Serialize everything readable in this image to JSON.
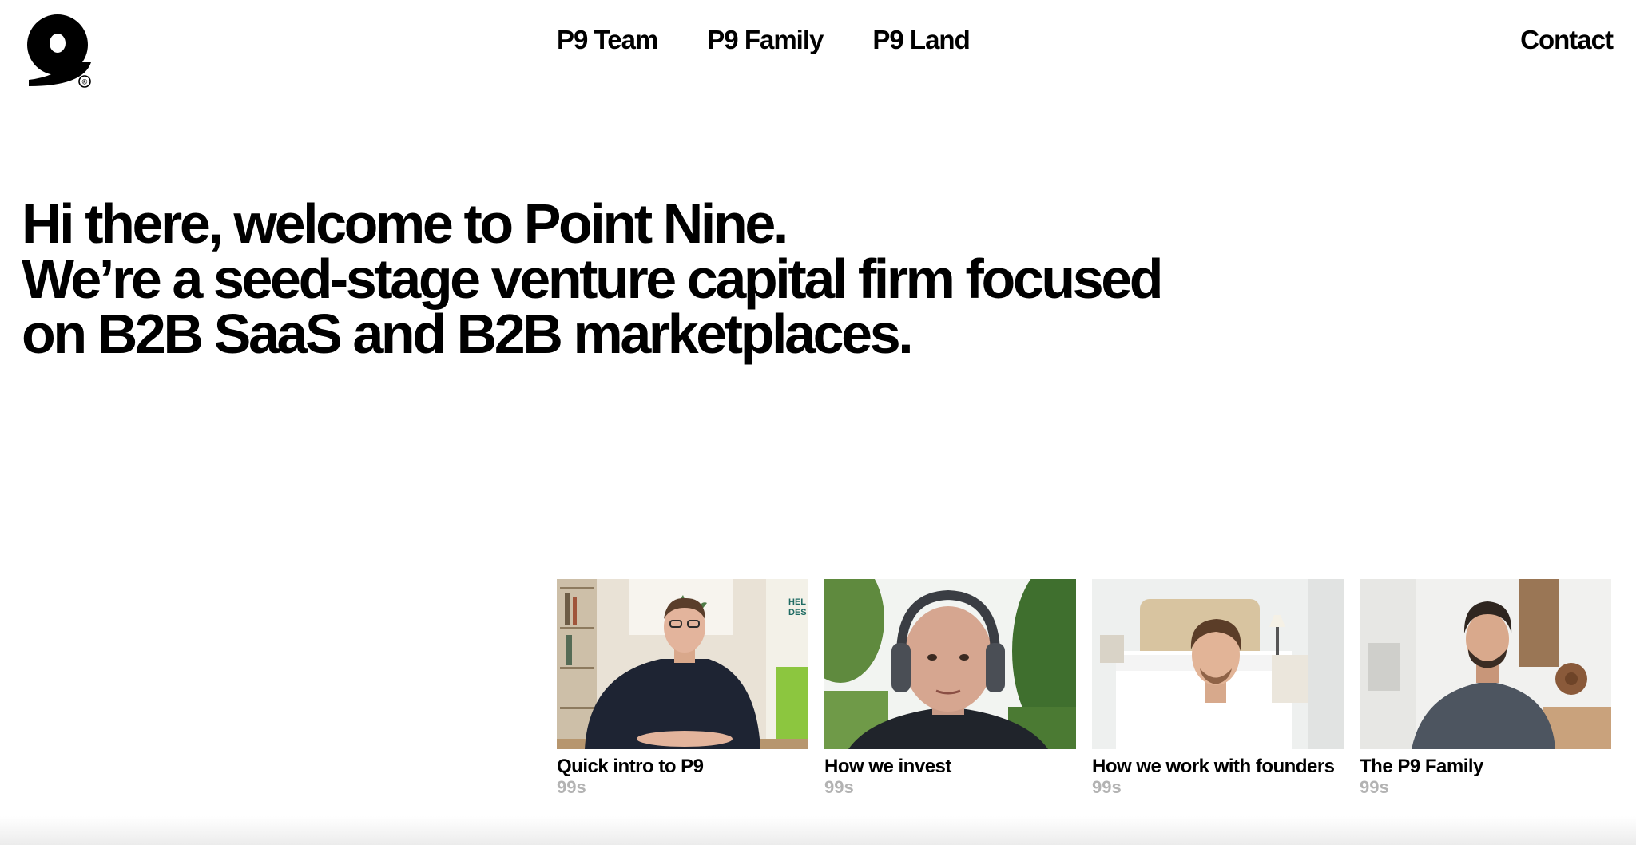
{
  "brand": {
    "logo_icon": "nine-logo-icon",
    "registered_mark": "®"
  },
  "nav": {
    "items": [
      {
        "label": "P9 Team"
      },
      {
        "label": "P9 Family"
      },
      {
        "label": "P9 Land"
      }
    ],
    "contact_label": "Contact"
  },
  "hero": {
    "lines": [
      "Hi there, welcome to Point Nine.",
      "We’re a seed-stage venture capital firm focused",
      "on B2B SaaS and B2B marketplaces."
    ]
  },
  "videos": [
    {
      "title": "Quick intro to P9",
      "duration": "99s"
    },
    {
      "title": "How we invest",
      "duration": "99s"
    },
    {
      "title": "How we work with founders",
      "duration": "99s"
    },
    {
      "title": "The P9 Family",
      "duration": "99s"
    }
  ],
  "colors": {
    "text": "#000000",
    "muted": "#b3b3b3",
    "background": "#ffffff"
  }
}
